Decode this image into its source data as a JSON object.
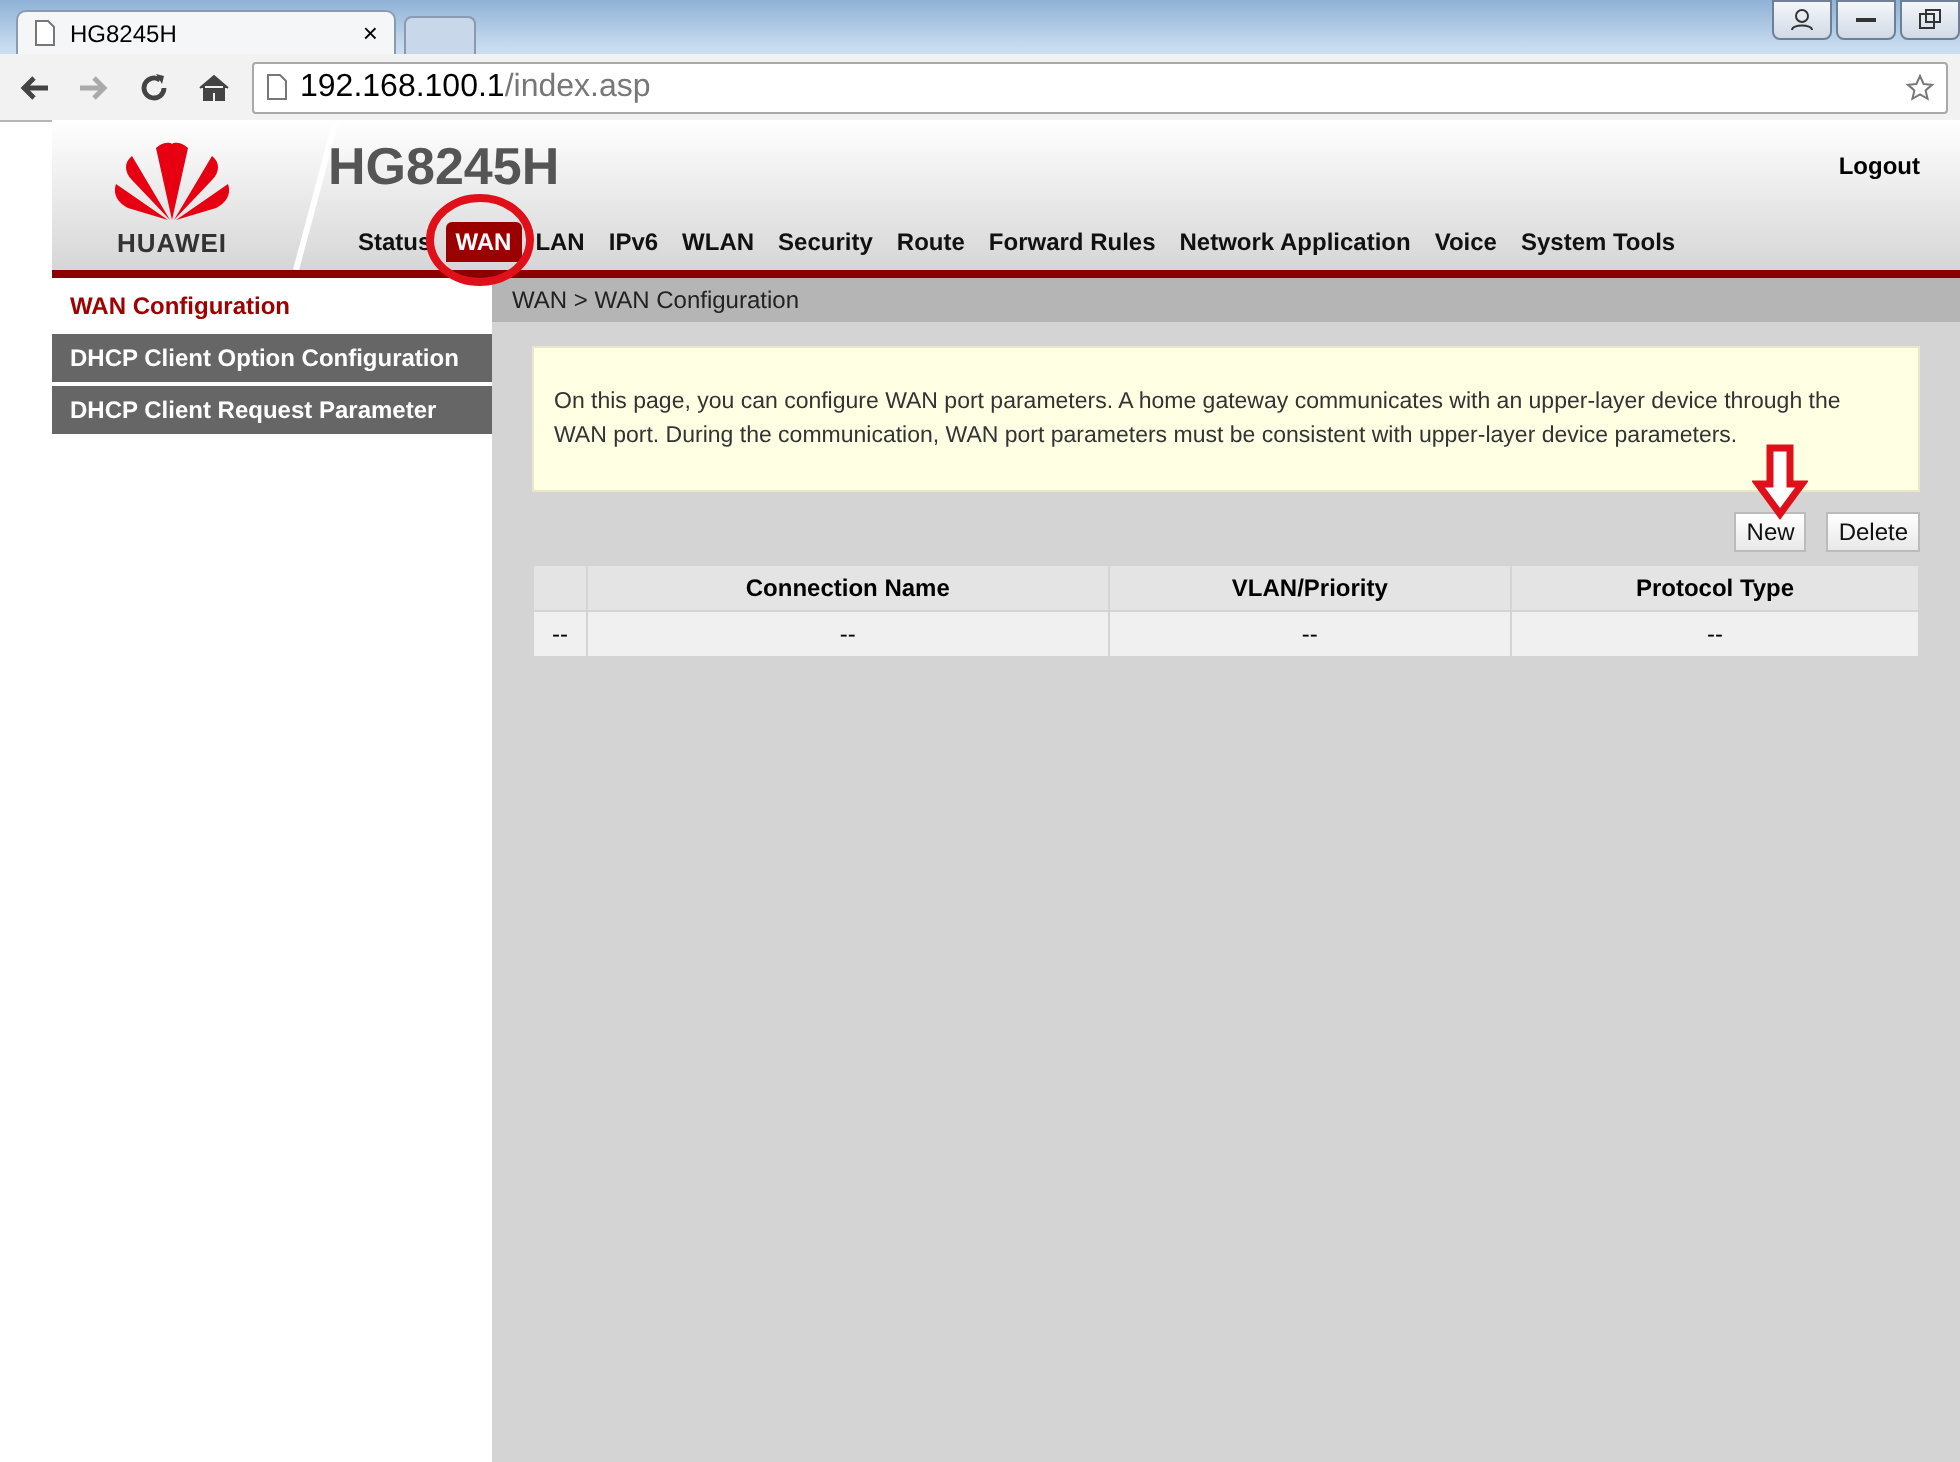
{
  "browser": {
    "tab": {
      "title": "HG8245H",
      "close": "×"
    },
    "address": {
      "host": "192.168.100.1",
      "path": "/index.asp"
    }
  },
  "header": {
    "brand": "HUAWEI",
    "model": "HG8245H",
    "logout": "Logout",
    "nav": [
      {
        "label": "Status",
        "selected": false
      },
      {
        "label": "WAN",
        "selected": true
      },
      {
        "label": "LAN",
        "selected": false
      },
      {
        "label": "IPv6",
        "selected": false
      },
      {
        "label": "WLAN",
        "selected": false
      },
      {
        "label": "Security",
        "selected": false
      },
      {
        "label": "Route",
        "selected": false
      },
      {
        "label": "Forward Rules",
        "selected": false
      },
      {
        "label": "Network Application",
        "selected": false
      },
      {
        "label": "Voice",
        "selected": false
      },
      {
        "label": "System Tools",
        "selected": false
      }
    ]
  },
  "sidebar": {
    "items": [
      {
        "label": "WAN Configuration",
        "selected": true
      },
      {
        "label": "DHCP Client Option Configuration",
        "selected": false
      },
      {
        "label": "DHCP Client Request Parameter",
        "selected": false
      }
    ]
  },
  "breadcrumb": "WAN > WAN Configuration",
  "notice": "On this page, you can configure WAN port parameters. A home gateway communicates with an upper-layer device through the WAN port. During the communication, WAN port parameters must be consistent with upper-layer device parameters.",
  "buttons": [
    "New",
    "Delete"
  ],
  "table": {
    "columns": [
      "",
      "Connection Name",
      "VLAN/Priority",
      "Protocol Type"
    ],
    "rows": [
      [
        "--",
        "--",
        "--",
        "--"
      ]
    ]
  }
}
